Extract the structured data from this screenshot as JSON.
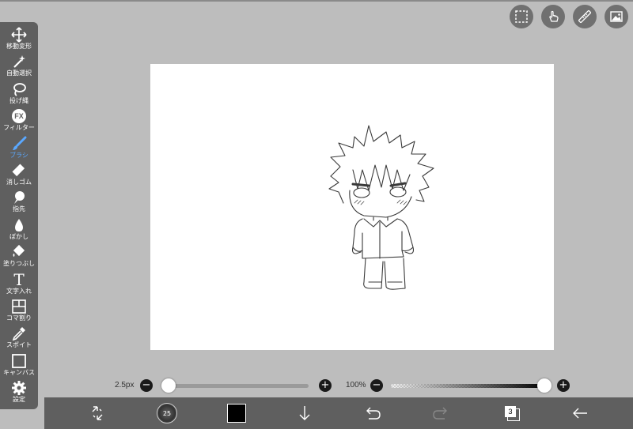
{
  "toolbar": {
    "tools": [
      {
        "label": "移動変形",
        "icon": "move-icon"
      },
      {
        "label": "自動選択",
        "icon": "magic-wand-icon"
      },
      {
        "label": "投げ縄",
        "icon": "lasso-icon"
      },
      {
        "label": "フィルター",
        "icon": "fx-icon",
        "icon_text": "FX"
      },
      {
        "label": "ブラシ",
        "icon": "brush-icon",
        "active": true
      },
      {
        "label": "消しゴム",
        "icon": "eraser-icon"
      },
      {
        "label": "指先",
        "icon": "finger-icon"
      },
      {
        "label": "ぼかし",
        "icon": "blur-drop-icon"
      },
      {
        "label": "塗りつぶし",
        "icon": "fill-bucket-icon"
      },
      {
        "label": "文字入れ",
        "icon": "text-icon",
        "icon_text": "T"
      },
      {
        "label": "コマ割り",
        "icon": "frame-divide-icon"
      },
      {
        "label": "スポイト",
        "icon": "eyedropper-icon"
      },
      {
        "label": "キャンバス",
        "icon": "canvas-icon"
      },
      {
        "label": "設定",
        "icon": "gear-icon"
      }
    ]
  },
  "top_right_buttons": [
    "selection-icon",
    "touch-hand-icon",
    "ruler-icon",
    "image-icon"
  ],
  "brush_size": {
    "label": "2.5px",
    "value_fraction": 0.0
  },
  "opacity": {
    "label": "100%",
    "value_fraction": 1.0
  },
  "bottom_bar": {
    "brush_preview_label": "25",
    "layer_count": "3",
    "current_color": "#000000"
  },
  "colors": {
    "active_tool": "#5aa8ff",
    "toolbar_bg": "#5f5f5f",
    "background": "#bdbdbd",
    "canvas": "#ffffff"
  }
}
